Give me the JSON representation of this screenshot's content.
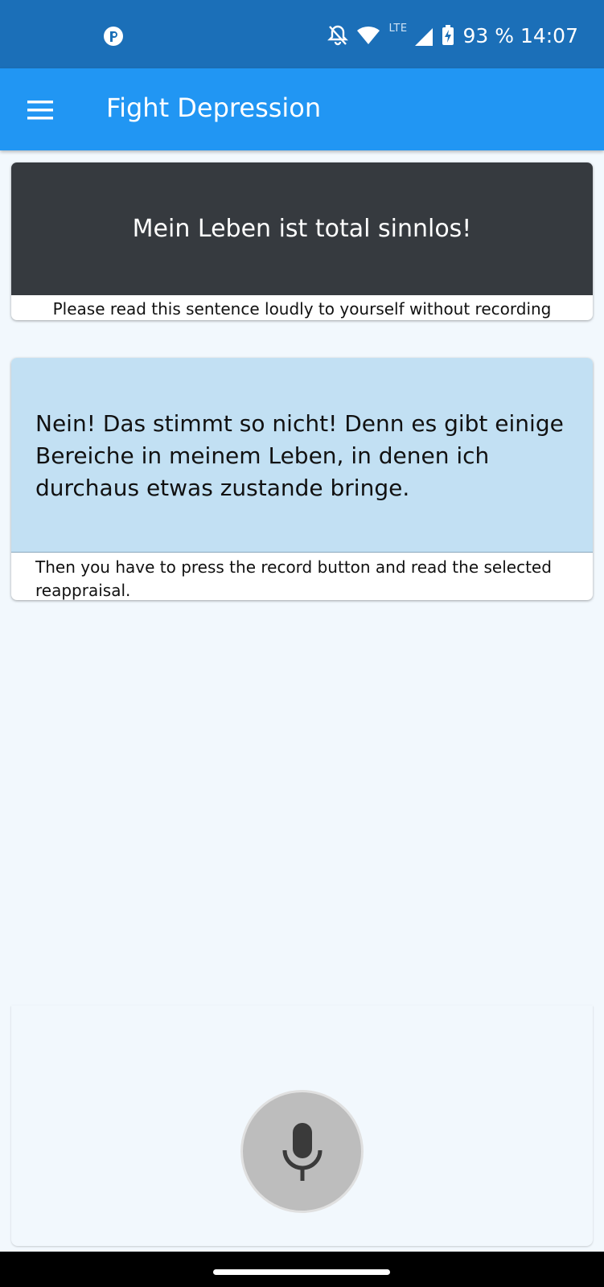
{
  "status_bar": {
    "lte_label": "LTE",
    "battery_time": "93 % 14:07",
    "icons": [
      "app-notification-icon",
      "notifications-off-icon",
      "wifi-icon",
      "signal-icon",
      "battery-charging-icon"
    ]
  },
  "app_bar": {
    "title": "Fight Depression",
    "menu_icon": "hamburger-menu-icon",
    "color": "#2196f3"
  },
  "sentence_card": {
    "sentence": "Mein Leben ist total sinnlos!",
    "instruction": "Please read this sentence loudly to yourself without recording",
    "color": "#363a3f"
  },
  "reappraisal_card": {
    "text": "Nein! Das stimmt so nicht! Denn es gibt einige Bereiche in meinem Leben, in denen ich durchaus etwas zustande bringe.",
    "instruction": "Then you have to press the record button and read the selected reappraisal.",
    "color": "#c2e0f3"
  },
  "record": {
    "icon": "microphone-icon"
  }
}
